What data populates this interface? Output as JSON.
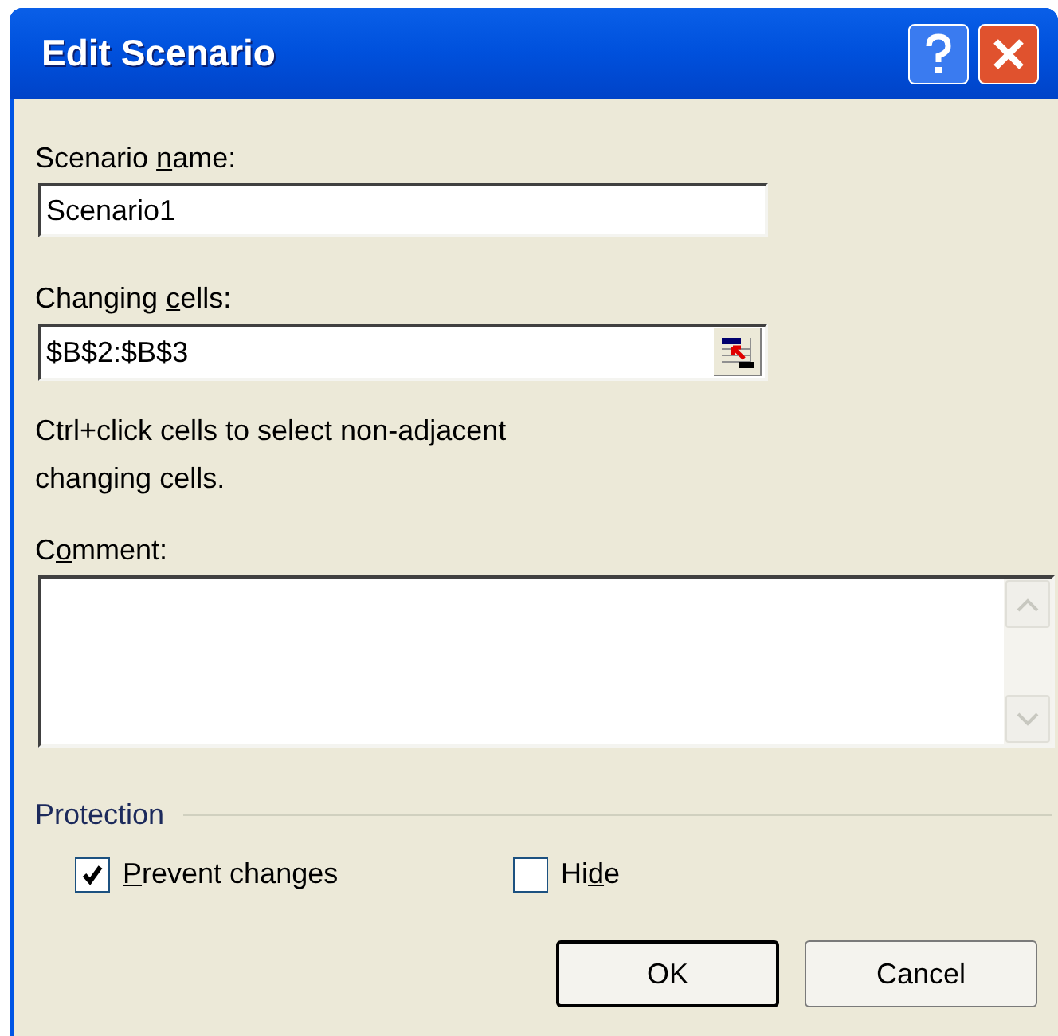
{
  "window": {
    "title": "Edit Scenario"
  },
  "scenario_name": {
    "label_before": "Scenario ",
    "mnemonic": "n",
    "label_after": "ame:",
    "value": "Scenario1"
  },
  "changing_cells": {
    "label_before": "Changing ",
    "mnemonic": "c",
    "label_after": "ells:",
    "value": "$B$2:$B$3"
  },
  "hint": "Ctrl+click cells to select non-adjacent changing cells.",
  "comment": {
    "label_before": "C",
    "mnemonic": "o",
    "label_after": "mment:"
  },
  "protection": {
    "label": "Protection",
    "options": [
      {
        "mnemonic": "P",
        "label_after": "revent changes",
        "checked": true
      },
      {
        "label_before": "Hi",
        "mnemonic": "d",
        "label_after": "e",
        "checked": false
      }
    ]
  },
  "buttons": [
    {
      "label": "OK",
      "default": true
    },
    {
      "label": "Cancel",
      "default": false
    }
  ]
}
